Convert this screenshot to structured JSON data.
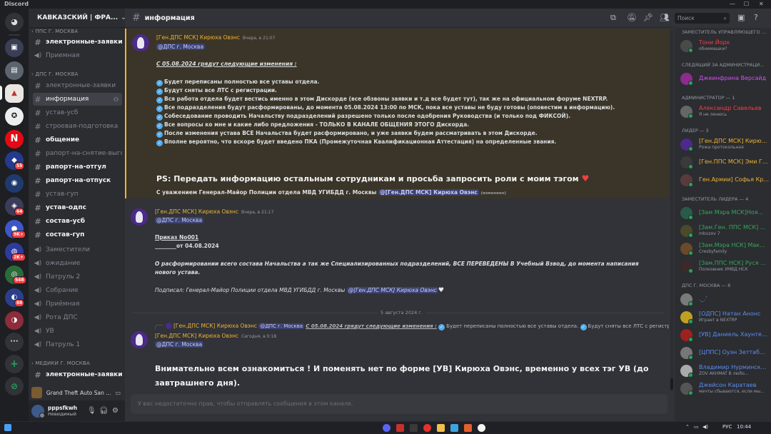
{
  "window": {
    "title": "Discord"
  },
  "server": {
    "name": "КАВКАЗСКИЙ | ФРА..."
  },
  "channels": {
    "categories": [
      "ППС Г. МОСКВА",
      "ДПС Г. МОСКВА",
      "МЕДИКИ Г. МОСКВА"
    ],
    "items": [
      {
        "label": "электронные-заявки",
        "kind": "text",
        "state": "unread"
      },
      {
        "label": "Приемная",
        "kind": "voice",
        "state": "normal"
      },
      {
        "label": "электронные-заявки",
        "kind": "text",
        "state": "normal"
      },
      {
        "label": "информация",
        "kind": "text",
        "state": "active"
      },
      {
        "label": "устав-усб",
        "kind": "text",
        "state": "normal"
      },
      {
        "label": "строевая-подготовка",
        "kind": "text",
        "state": "normal"
      },
      {
        "label": "общение",
        "kind": "text",
        "state": "unread"
      },
      {
        "label": "рапорт-на-снятие-выго...",
        "kind": "text",
        "state": "normal"
      },
      {
        "label": "рапорт-на-отгул",
        "kind": "text",
        "state": "unread"
      },
      {
        "label": "рапорт-на-отпуск",
        "kind": "text",
        "state": "unread"
      },
      {
        "label": "устав-гуп",
        "kind": "text",
        "state": "normal"
      },
      {
        "label": "устав-одпс",
        "kind": "text",
        "state": "unread"
      },
      {
        "label": "состав-усб",
        "kind": "text",
        "state": "unread"
      },
      {
        "label": "состав-гуп",
        "kind": "text",
        "state": "unread"
      },
      {
        "label": "Заместители",
        "kind": "voice",
        "state": "normal"
      },
      {
        "label": "ожидание",
        "kind": "voice",
        "state": "normal"
      },
      {
        "label": "Патруль 2",
        "kind": "voice",
        "state": "normal"
      },
      {
        "label": "Собрание",
        "kind": "voice",
        "state": "normal"
      },
      {
        "label": "Приёмная",
        "kind": "voice",
        "state": "normal"
      },
      {
        "label": "Рота ДПС",
        "kind": "voice",
        "state": "normal"
      },
      {
        "label": "УВ",
        "kind": "voice",
        "state": "normal"
      },
      {
        "label": "Патруль 1",
        "kind": "voice",
        "state": "normal"
      },
      {
        "label": "электронные-заявки",
        "kind": "text",
        "state": "unread"
      }
    ]
  },
  "activity": {
    "label": "Grand Theft Auto San ..."
  },
  "user": {
    "name": "pppsfkwh",
    "status": "Невидимый"
  },
  "guild_badges": [
    "55",
    "64",
    "9K+",
    "2K+",
    "548",
    "88"
  ],
  "header": {
    "channel": "информация",
    "search_placeholder": "Поиск"
  },
  "messages": {
    "m1": {
      "author": "[Ген.ДПС МСК] Кирюха Овэнс",
      "time": "Вчера, в 21:07",
      "mention": "@ДПС г. Москва",
      "heading": "С 05.08.2024 грядут следующие изменения :",
      "items": [
        "Будет переписаны полностью все уставы отдела.",
        "Будут сняты все ЛТС с регистрации.",
        "Вся работа отдела будет вестись именно в этом Дискорде (все обзвоны заявки и т.д все будет тут), так же на официальном форуме NEXTRP.",
        "Все подразделения будут расформированы, до момента 05.08.2024 13:00 по МСК, пока все уставы не буду готовы (оповестим в информацию).",
        "Собеседование проводить Начальству подразделений разрешено только после одобрения Руководства (и только под ФИКСОЙ).",
        "Все вопросы ко мне и какие либо предложения - ТОЛЬКО В КАНАЛЕ ОБЩЕНИЯ ЭТОГО Дискорда.",
        "После изменения устава ВСЕ Начальства будет расформировано, и уже заявки будем рассматривать в этом Дискорде.",
        "Вполне вероятно, что вскоре будет введено ПКА (Промежуточная Квалификационная Аттестация) на определенные звания."
      ],
      "ps": "PS: Передать информацию остальным сотрудникам и просьба запросить роли с моим тэгом",
      "signature": "С уважением Генерал-Майор Полиции отдела МВД УГИБДД г. Москвы",
      "signature_mention": "@[Ген.ДПС МСК] Кирюха Овэнс",
      "edited": "(изменено)"
    },
    "m2": {
      "author": "[Ген.ДПС МСК] Кирюха Овэнс",
      "time": "Вчера, в 21:17",
      "mention": "@ДПС г. Москва",
      "order": "Приказ No001",
      "date": "________от 04.08.2024",
      "text_1": "О расформировании всего состава Начальства а так же Специализированных подразделений, ВСЕ ПЕРЕВЕДЕНЫ В Учебный Взвод, до момента написания",
      "text_2": "нового устава.",
      "signed": "Подписал: Генерал-Майор Полиции отдела МВД УГИБДД г. Москвы",
      "signed_mention": "@[Ген.ДПС МСК] Кирюха Овэнс"
    },
    "date_divider": "5 августа 2024 г.",
    "reply": {
      "author": "[Ген.ДПС МСК] Кирюха Овэнс",
      "mention": "@ДПС г. Москва",
      "heading": "С 05.08.2024 грядут следующие изменения :",
      "text_1": "Будет переписаны полностью все уставы отдела.",
      "text_2": "Будут сняты все ЛТС с регистрация..."
    },
    "m3": {
      "author": "[Ген.ДПС МСК] Кирюха Овэнс",
      "time": "Сегодня, в 0:18",
      "mention": "@ДПС г. Москва",
      "text_1": "Внимательно всем ознакомиться ! И поменять нет по форме [УВ] Кирюха Овэнс, временно у всех тэг УВ  (до",
      "text_2": "завтрашнего дня)."
    }
  },
  "composer": {
    "placeholder": "У вас недостаточно прав, чтобы отправлять сообщения в этом канале."
  },
  "members": {
    "groups": [
      {
        "title": "ЗАМЕСТИТЕЛЬ УПРАВЛЯЮЩЕГО ...",
        "members": [
          {
            "name": "Тони Йорк",
            "sub": "обнимашки?",
            "color": "#f23f43"
          }
        ]
      },
      {
        "title": "СЛЕДЯЩИЙ ЗА АДМИНИСТРАЦИ...",
        "members": [
          {
            "name": "Джеинфрина Версайд",
            "sub": "",
            "color": "#d64df5"
          }
        ]
      },
      {
        "title": "АДМИНИСТРАТОР — 1",
        "members": [
          {
            "name": "Александр Савельев",
            "sub": "Я не ленюсь",
            "color": "#f23f43"
          }
        ]
      },
      {
        "title": "ЛИДЕР — 3",
        "members": [
          {
            "name": "[Ген.ДПС МСК] Кирю...",
            "sub": "Рожа протокольная",
            "color": "#f0b232"
          },
          {
            "name": "[Ген.ППС МСК] Эми Г...",
            "sub": "",
            "color": "#f0b232"
          },
          {
            "name": "Ген.Армии] Софья Кр...",
            "sub": "",
            "color": "#f0b232"
          }
        ]
      },
      {
        "title": "ЗАМЕСТИТЕЛЬ ЛИДЕРА — 4",
        "members": [
          {
            "name": "[Зам Мэра МСК]Ноя...",
            "sub": "",
            "color": "#3ba55c"
          },
          {
            "name": "[Зам.Ген. ППС МСК] ...",
            "sub": "mbuzov 7",
            "color": "#3ba55c"
          },
          {
            "name": "[Зам.Мэра НСК] Мак...",
            "sub": "Cresbyfamily",
            "color": "#3ba55c"
          },
          {
            "name": "[Зам.ППС НСК] Руся ...",
            "sub": "Полковник УМВД НСК",
            "color": "#3ba55c"
          }
        ]
      },
      {
        "title": "ДПС Г. МОСКВА — 8",
        "members": [
          {
            "name": "._.'",
            "sub": "",
            "color": "#5b8def"
          },
          {
            "name": "[ОДПС] Натан Анонс",
            "sub": "Играет в NEXTRP",
            "color": "#5b8def"
          },
          {
            "name": "[УВ] Даниель Хаунте...",
            "sub": "",
            "color": "#5b8def"
          },
          {
            "name": "[ЦППС] Оуэн Зеттаб...",
            "sub": "",
            "color": "#5b8def"
          },
          {
            "name": "Владимир Нурминск...",
            "sub": "ZOV AKHMAT В любо...",
            "color": "#5b8def"
          },
          {
            "name": "Джейсон Каратаев",
            "sub": "мечты сбываются, если мы...",
            "color": "#5b8def"
          }
        ]
      }
    ]
  },
  "taskbar": {
    "lang": "РУС",
    "time": "10:44"
  }
}
